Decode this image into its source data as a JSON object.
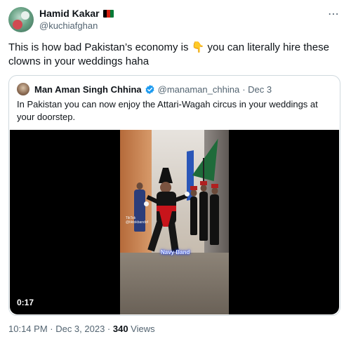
{
  "tweet": {
    "display_name": "Hamid Kakar",
    "handle": "@kuchiafghan",
    "flag_colors": [
      "#000000",
      "#d32011",
      "#007a36"
    ],
    "text": "This is how bad Pakistan’s economy is 👇 you can literally hire these clowns in your weddings haha",
    "more_icon": "⋯",
    "timestamp": "10:14 PM · Dec 3, 2023 · ",
    "views_count": "340",
    "views_label": " Views"
  },
  "quote": {
    "display_name": "Man Aman Singh Chhina",
    "verified_color": "#1d9bf0",
    "handle": "@manaman_chhina",
    "date": "· Dec 3",
    "text": "In Pakistan you can now enjoy the Attari-Wagah circus in your weddings at your doorstep.",
    "video": {
      "duration": "0:17",
      "watermark": "Navy Band",
      "tiktok_text": "TikTok\n@tiktokbandof"
    }
  },
  "colors": {
    "text_primary": "#0f1419",
    "text_secondary": "#536471",
    "border": "#cfd9de"
  }
}
